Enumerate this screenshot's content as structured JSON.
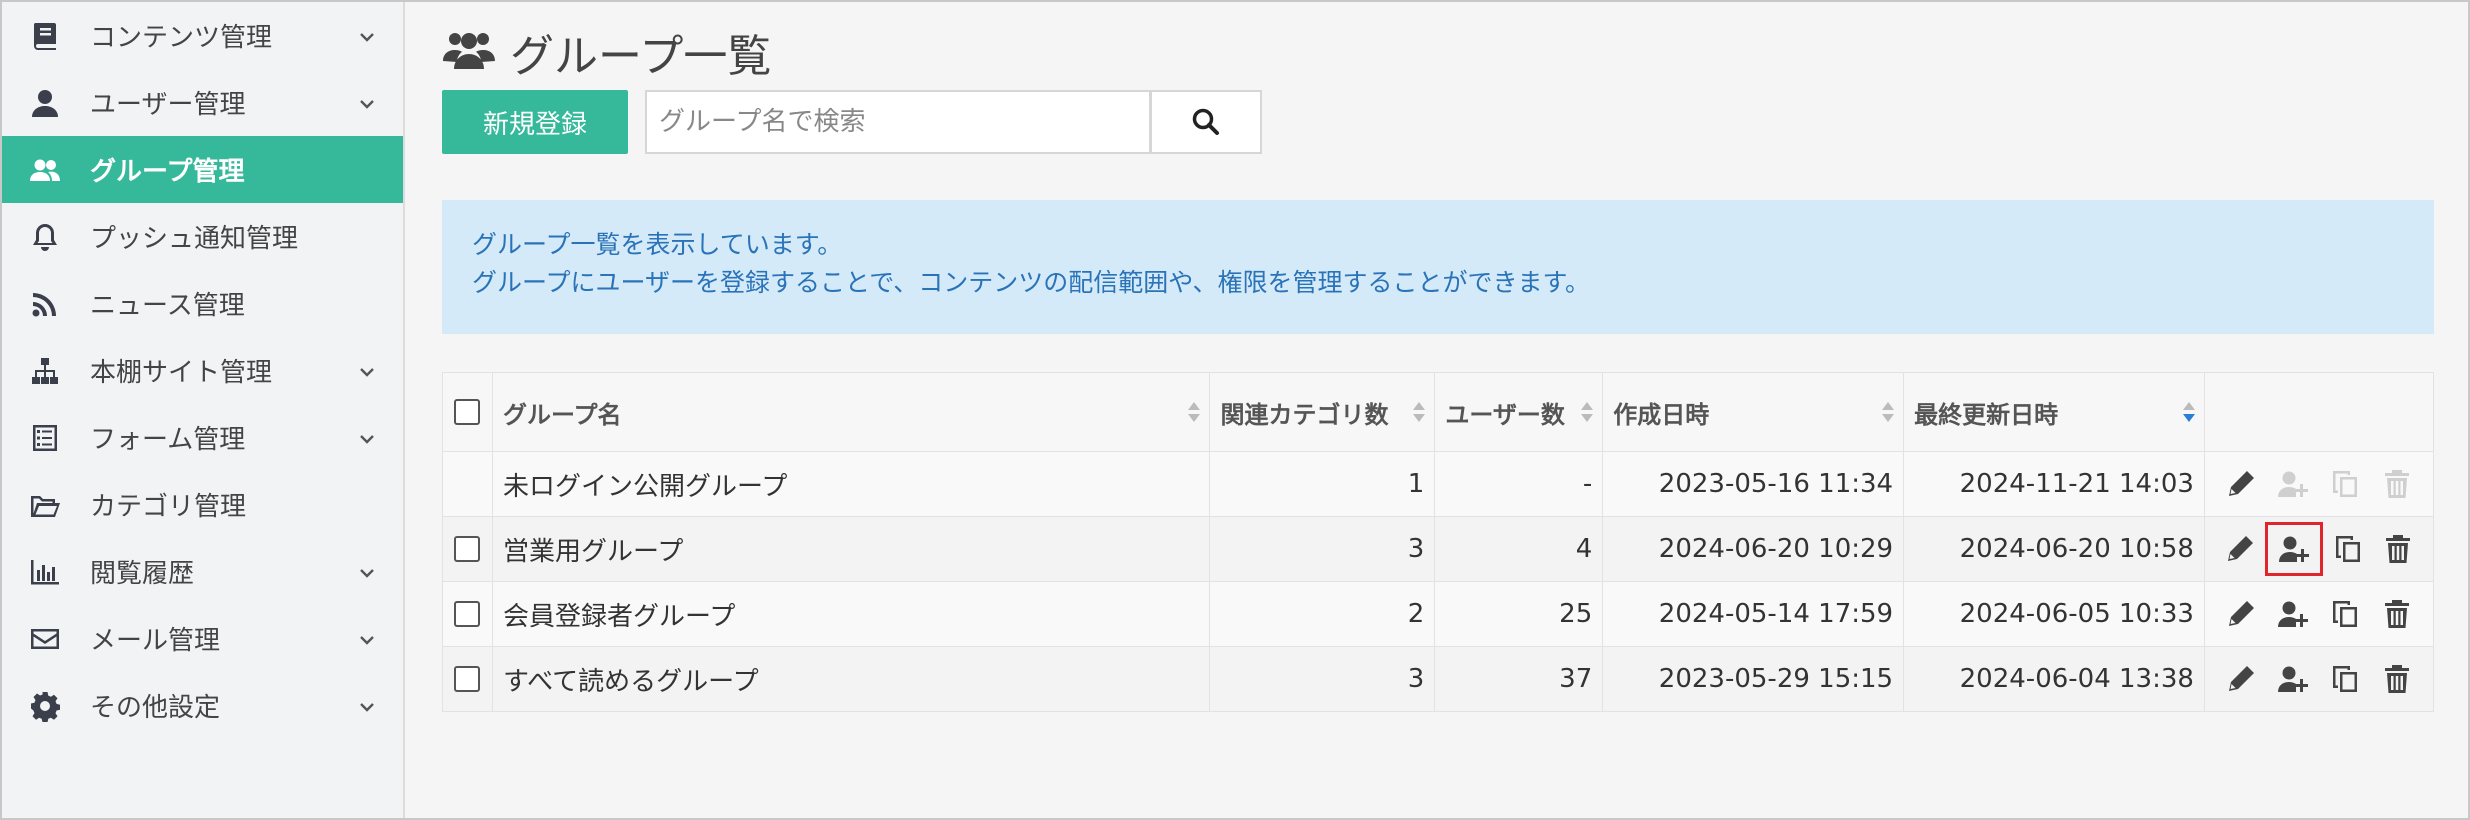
{
  "sidebar": {
    "items": [
      {
        "label": "コンテンツ管理",
        "icon": "book-icon",
        "has_submenu": true,
        "active": false
      },
      {
        "label": "ユーザー管理",
        "icon": "user-icon",
        "has_submenu": true,
        "active": false
      },
      {
        "label": "グループ管理",
        "icon": "users-icon",
        "has_submenu": false,
        "active": true
      },
      {
        "label": "プッシュ通知管理",
        "icon": "bell-icon",
        "has_submenu": false,
        "active": false
      },
      {
        "label": "ニュース管理",
        "icon": "rss-icon",
        "has_submenu": false,
        "active": false
      },
      {
        "label": "本棚サイト管理",
        "icon": "sitemap-icon",
        "has_submenu": true,
        "active": false
      },
      {
        "label": "フォーム管理",
        "icon": "form-icon",
        "has_submenu": true,
        "active": false
      },
      {
        "label": "カテゴリ管理",
        "icon": "folder-open-icon",
        "has_submenu": false,
        "active": false
      },
      {
        "label": "閲覧履歴",
        "icon": "bar-chart-icon",
        "has_submenu": true,
        "active": false
      },
      {
        "label": "メール管理",
        "icon": "mail-icon",
        "has_submenu": true,
        "active": false
      },
      {
        "label": "その他設定",
        "icon": "gear-icon",
        "has_submenu": true,
        "active": false
      }
    ]
  },
  "page": {
    "title": "グループ一覧",
    "new_button": "新規登録",
    "search_placeholder": "グループ名で検索"
  },
  "info": {
    "line1": "グループ一覧を表示しています。",
    "line2": "グループにユーザーを登録することで、コンテンツの配信範囲や、権限を管理することができます。"
  },
  "table": {
    "headers": {
      "name": "グループ名",
      "categories": "関連カテゴリ数",
      "users": "ユーザー数",
      "created": "作成日時",
      "updated": "最終更新日時"
    },
    "rows": [
      {
        "name": "未ログイン公開グループ",
        "categories": "1",
        "users": "-",
        "created": "2023-05-16 11:34",
        "updated": "2024-11-21 14:03",
        "checkbox": false,
        "disabled": true,
        "highlight_add_user": false
      },
      {
        "name": "営業用グループ",
        "categories": "3",
        "users": "4",
        "created": "2024-06-20 10:29",
        "updated": "2024-06-20 10:58",
        "checkbox": true,
        "disabled": false,
        "highlight_add_user": true
      },
      {
        "name": "会員登録者グループ",
        "categories": "2",
        "users": "25",
        "created": "2024-05-14 17:59",
        "updated": "2024-06-05 10:33",
        "checkbox": true,
        "disabled": false,
        "highlight_add_user": false
      },
      {
        "name": "すべて読めるグループ",
        "categories": "3",
        "users": "37",
        "created": "2023-05-29 15:15",
        "updated": "2024-06-04 13:38",
        "checkbox": true,
        "disabled": false,
        "highlight_add_user": false
      }
    ]
  },
  "colors": {
    "accent": "#35b99a",
    "info_bg": "#d4eaf8",
    "info_text": "#2a73b8",
    "highlight_border": "#e0262c",
    "sort_active": "#2a7fd4"
  }
}
